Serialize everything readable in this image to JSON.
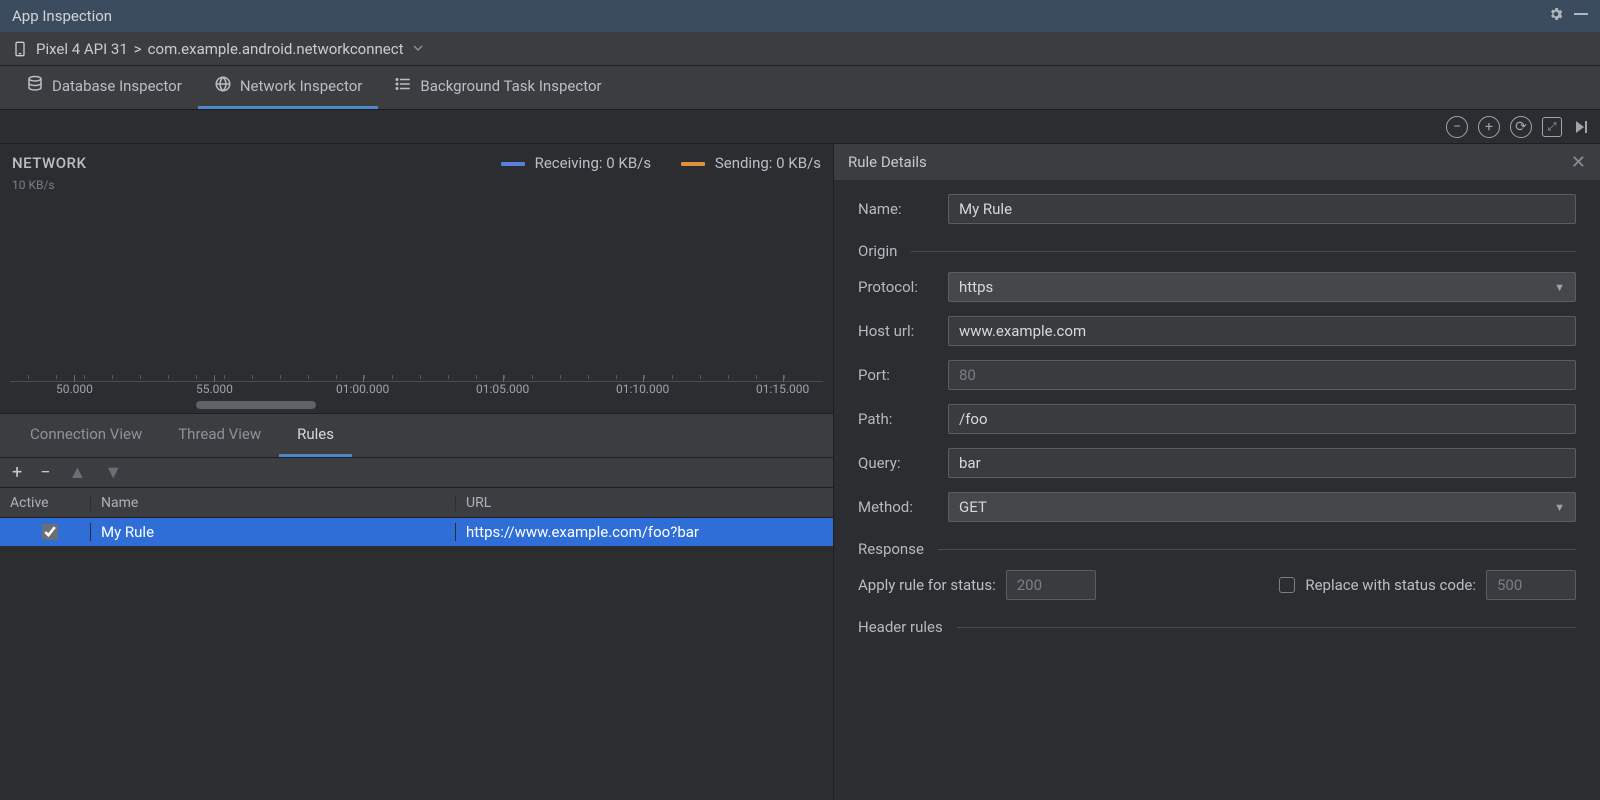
{
  "titlebar": {
    "title": "App Inspection"
  },
  "breadcrumb": {
    "device": "Pixel 4 API 31",
    "separator": ">",
    "process": "com.example.android.networkconnect"
  },
  "inspectorTabs": {
    "database": "Database Inspector",
    "network": "Network Inspector",
    "background": "Background Task Inspector"
  },
  "network": {
    "title": "NETWORK",
    "yaxis": "10 KB/s",
    "legend": {
      "receivingLabel": "Receiving:",
      "receivingValue": "0 KB/s",
      "sendingLabel": "Sending:",
      "sendingValue": "0 KB/s",
      "receivingColor": "#5a7fd6",
      "sendingColor": "#e08f3f"
    },
    "ticks": [
      "50.000",
      "55.000",
      "01:00.000",
      "01:05.000",
      "01:10.000",
      "01:15.000"
    ]
  },
  "lowerTabs": {
    "connection": "Connection View",
    "thread": "Thread View",
    "rules": "Rules"
  },
  "rulesTable": {
    "headers": {
      "active": "Active",
      "name": "Name",
      "url": "URL"
    },
    "rows": [
      {
        "active": true,
        "name": "My Rule",
        "url": "https://www.example.com/foo?bar"
      }
    ]
  },
  "ruleDetails": {
    "title": "Rule Details",
    "nameLabel": "Name:",
    "nameValue": "My Rule",
    "originSection": "Origin",
    "protocolLabel": "Protocol:",
    "protocolValue": "https",
    "hostLabel": "Host url:",
    "hostValue": "www.example.com",
    "portLabel": "Port:",
    "portPlaceholder": "80",
    "pathLabel": "Path:",
    "pathValue": "/foo",
    "queryLabel": "Query:",
    "queryValue": "bar",
    "methodLabel": "Method:",
    "methodValue": "GET",
    "responseSection": "Response",
    "applyStatusLabel": "Apply rule for status:",
    "applyStatusPlaceholder": "200",
    "replaceLabel": "Replace with status code:",
    "replacePlaceholder": "500",
    "headerRulesSection": "Header rules"
  }
}
